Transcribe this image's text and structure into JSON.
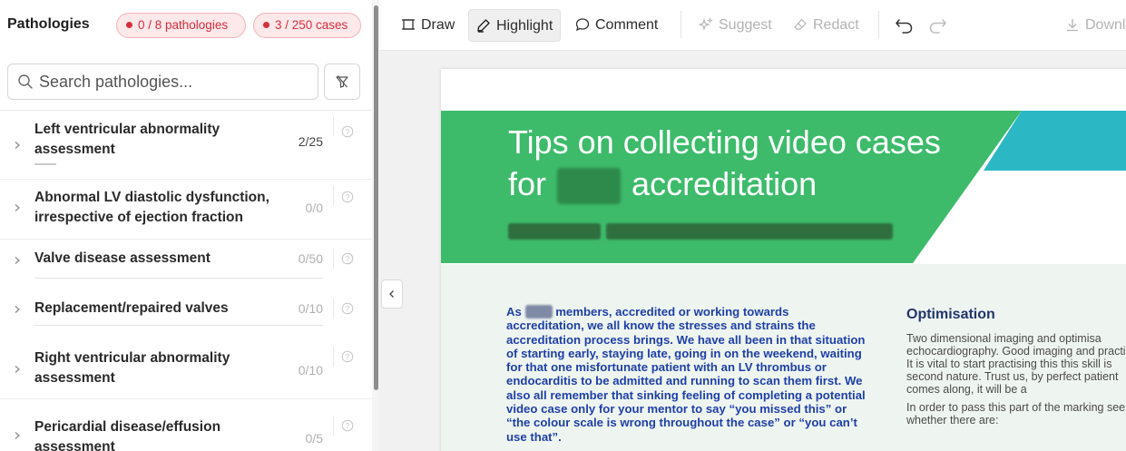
{
  "sidebar": {
    "title": "Pathologies",
    "pathologies_badge": "0 / 8 pathologies",
    "cases_badge": "3 / 250 cases",
    "search_placeholder": "Search pathologies...",
    "items": [
      {
        "label": "Left ventricular abnormality assessment",
        "count": "2/25",
        "progress": 0.08
      },
      {
        "label": "Abnormal LV diastolic dysfunction, irrespective of ejection fraction",
        "count": "0/0"
      },
      {
        "label": "Valve disease assessment",
        "count": "0/50"
      },
      {
        "label": "Replacement/repaired valves",
        "count": "0/10"
      },
      {
        "label": "Right ventricular abnormality assessment",
        "count": "0/10"
      },
      {
        "label": "Pericardial disease/effusion assessment",
        "count": "0/5"
      }
    ]
  },
  "toolbar": {
    "draw": "Draw",
    "highlight": "Highlight",
    "comment": "Comment",
    "suggest": "Suggest",
    "redact": "Redact",
    "download": "Downlo"
  },
  "document": {
    "title_line1": "Tips on collecting video cases",
    "title_line2_pre": "for",
    "title_line2_post": "accreditation",
    "intro_pre": "As",
    "intro_post": "members, accredited or working towards accreditation, we all know the stresses and strains the accreditation process brings. We have all been in that situation of starting early, staying late, going in on the weekend, waiting for that one misfortunate patient with an LV thrombus or endocarditis to be admitted and running to scan them first. We also all remember that sinking feeling of completing a potential video case only for your mentor to say “you missed this” or “the colour scale is wrong throughout the case” or “you can’t use that”.",
    "section_title": "Optimisation",
    "section_p1": "Two dimensional imaging and optimisa echocardiography. Good imaging and practice. It is vital to start practising this this skill is second nature. Trust us, by perfect patient comes along, it will be a",
    "section_p2": "In order to pass this part of the marking see whether there are:"
  },
  "colors": {
    "accent_red": "#d62f3c",
    "banner_green": "#3dbb6b",
    "banner_teal": "#2bb7c4",
    "body_blue": "#1f3fa8"
  }
}
